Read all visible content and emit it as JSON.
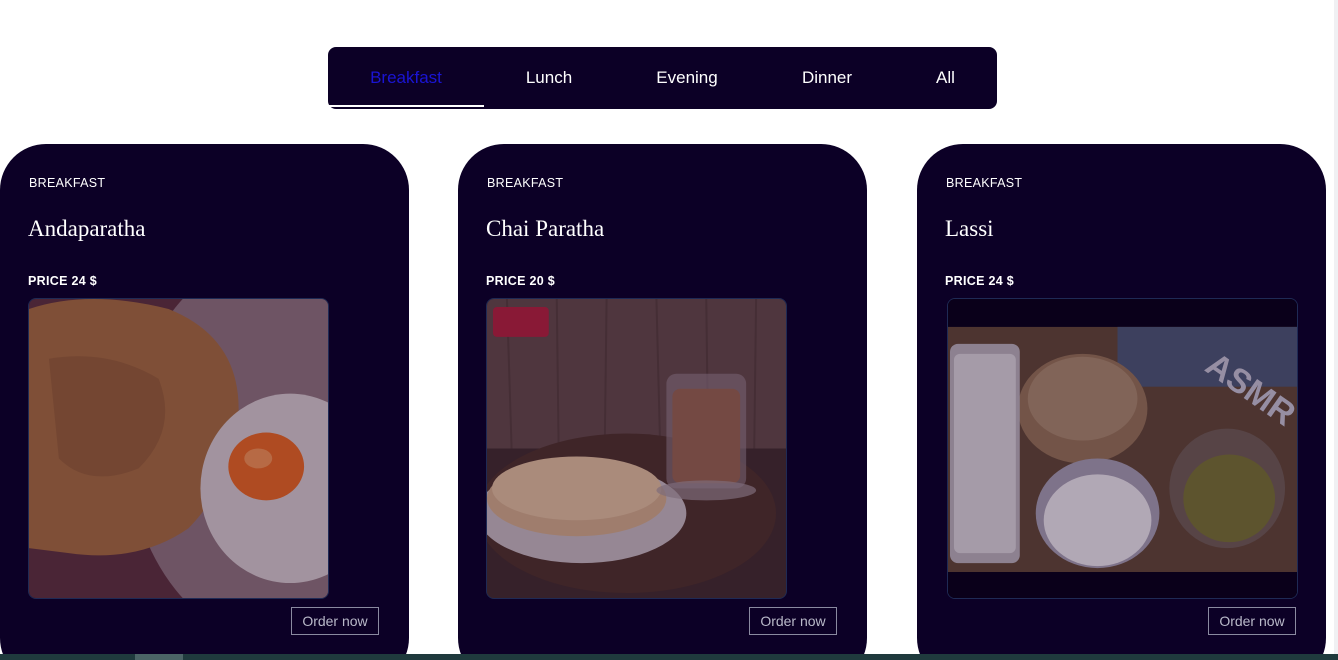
{
  "tabs": [
    {
      "label": "Breakfast",
      "active": true
    },
    {
      "label": "Lunch",
      "active": false
    },
    {
      "label": "Evening",
      "active": false
    },
    {
      "label": "Dinner",
      "active": false
    },
    {
      "label": "All",
      "active": false
    }
  ],
  "cards": [
    {
      "category": "BREAKFAST",
      "name": "Andaparatha",
      "price": "PRICE 24 $",
      "image": "andaparatha-photo",
      "order_label": "Order now"
    },
    {
      "category": "BREAKFAST",
      "name": "Chai Paratha",
      "price": "PRICE 20 $",
      "image": "chai-paratha-photo",
      "order_label": "Order now"
    },
    {
      "category": "BREAKFAST",
      "name": "Lassi",
      "price": "PRICE 24 $",
      "image": "lassi-photo",
      "image_overlay_text": "ASMR",
      "order_label": "Order now"
    }
  ],
  "colors": {
    "card_bg": "#0c0026",
    "active_tab": "#1a14d4",
    "text": "#ffffff"
  }
}
